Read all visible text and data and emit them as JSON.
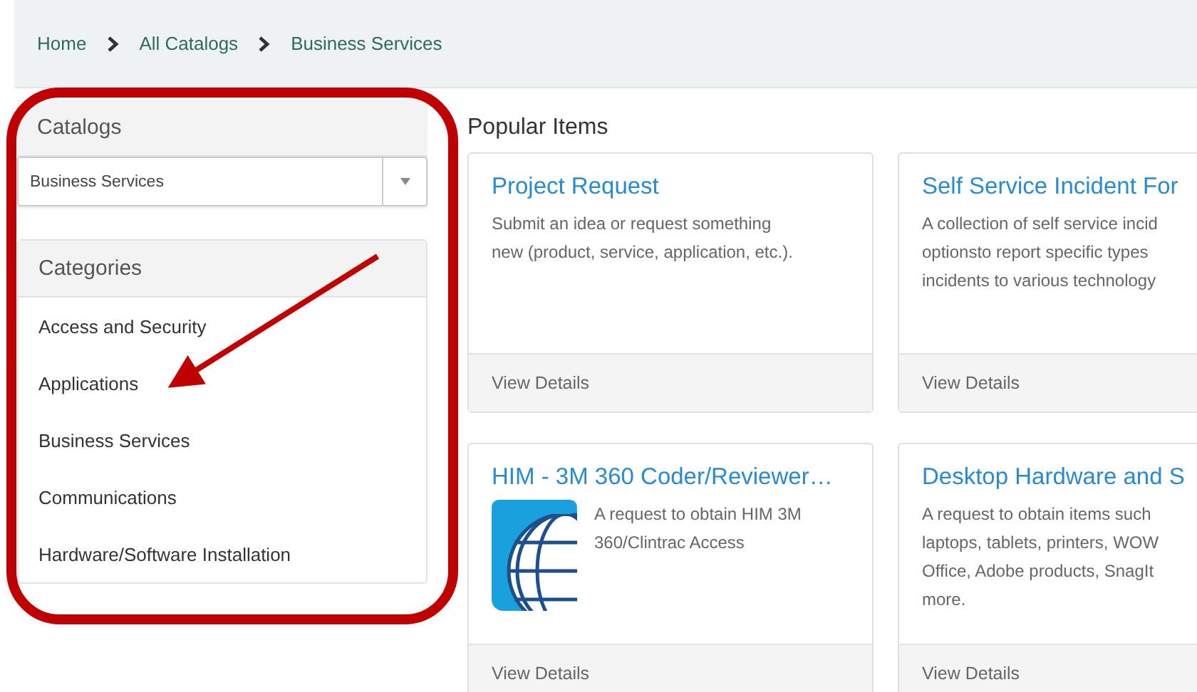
{
  "breadcrumb": [
    {
      "label": "Home"
    },
    {
      "label": "All Catalogs"
    },
    {
      "label": "Business Services"
    }
  ],
  "sidebar": {
    "catalogs_title": "Catalogs",
    "catalog_select": {
      "value": "Business Services"
    },
    "categories_title": "Categories",
    "categories": [
      {
        "label": "Access and Security"
      },
      {
        "label": "Applications"
      },
      {
        "label": "Business Services"
      },
      {
        "label": "Communications"
      },
      {
        "label": "Hardware/Software Installation"
      }
    ]
  },
  "popular": {
    "title": "Popular Items",
    "items": [
      {
        "title": "Project Request",
        "description": [
          "Submit an idea or request something",
          "new (product, service, application, etc.)."
        ],
        "link": "View Details"
      },
      {
        "title": "Self Service Incident For",
        "description": [
          "A collection of self service incid",
          "optionsto report specific types",
          "incidents to various technology"
        ],
        "link": "View Details"
      },
      {
        "title": "HIM - 3M 360 Coder/Reviewer…",
        "kind": "picture",
        "description": [
          "A request to obtain HIM 3M",
          "360/Clintrac Access"
        ],
        "link": "View Details"
      },
      {
        "title": "Desktop Hardware and S",
        "description": [
          "A request to obtain items such",
          "laptops, tablets, printers, WOW",
          "Office, Adobe products, SnagIt",
          "more."
        ],
        "link": "View Details"
      }
    ]
  }
}
